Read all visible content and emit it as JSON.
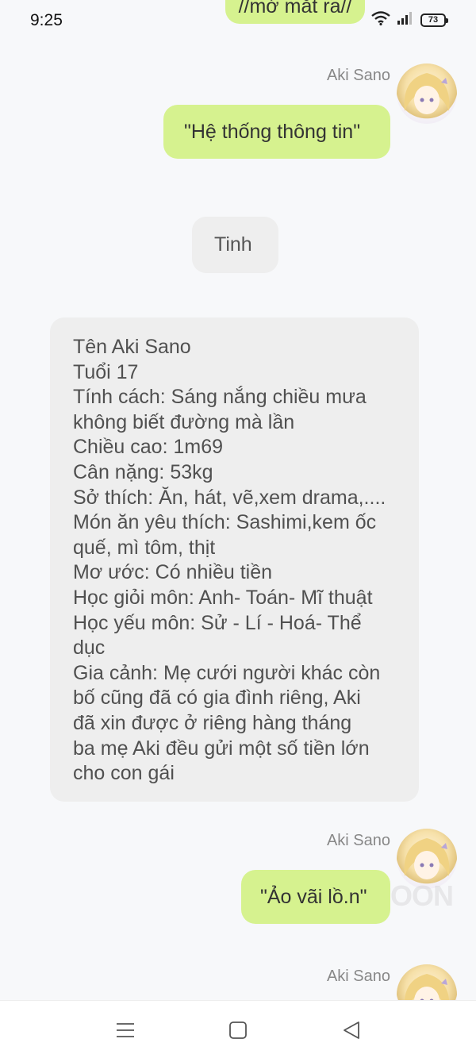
{
  "status_bar": {
    "time": "9:25",
    "battery_level": "73",
    "wifi_icon": "wifi-icon",
    "signal_icon": "signal-icon"
  },
  "messages": {
    "top_partial": "//mở mắt ra//",
    "msg1": {
      "sender": "Aki Sano",
      "text": "\"Hệ thống thông tin\""
    },
    "msg2": {
      "text": "Tinh"
    },
    "msg3": {
      "lines": "Tên Aki Sano\nTuổi 17\nTính cách: Sáng nắng chiều mưa\nkhông biết đường mà lần\nChiều cao: 1m69\nCân nặng: 53kg\nSở thích: Ăn, hát, vẽ,xem drama,....\nMón ăn yêu thích: Sashimi,kem ốc\nquế, mì tôm, thịt\nMơ ước: Có nhiều tiền\nHọc giỏi môn: Anh- Toán- Mĩ thuật\nHọc yếu môn: Sử - Lí - Hoá- Thể\ndục\nGia cảnh: Mẹ cưới người khác còn\nbố cũng đã có gia đình riêng, Aki\nđã xin được ở riêng hàng tháng\nba mẹ Aki đều gửi một số tiền lớn\ncho con gái"
    },
    "msg4": {
      "sender": "Aki Sano",
      "text": "\"Ảo vãi lồ.n\""
    },
    "msg5": {
      "sender": "Aki Sano"
    }
  },
  "watermark": "OON",
  "nav": {
    "menu_icon": "menu-icon",
    "home_icon": "home-icon",
    "back_icon": "back-icon"
  },
  "colors": {
    "user_bubble": "#d6f28f",
    "system_bubble": "#eeeeee",
    "background": "#f7f8fa"
  }
}
